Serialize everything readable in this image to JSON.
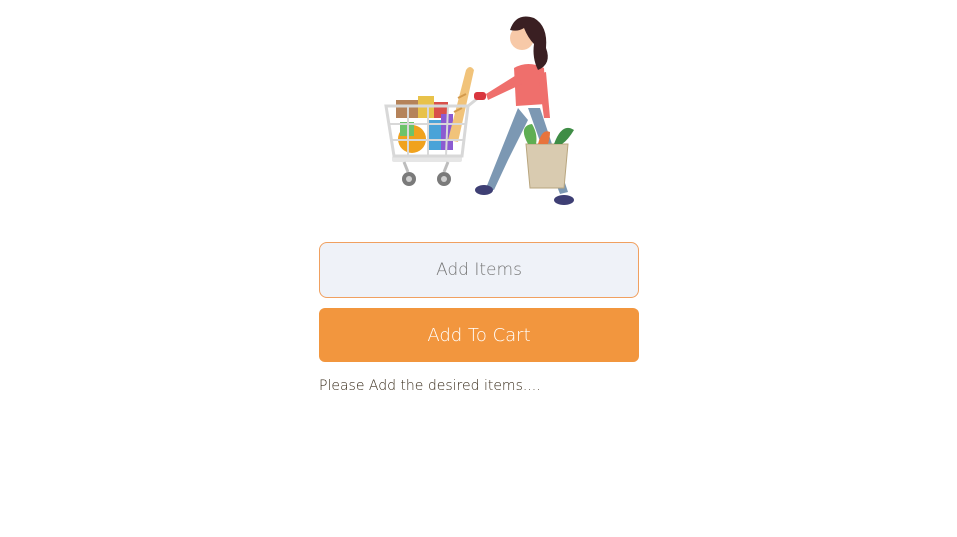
{
  "illustration": {
    "description_icon": "woman-pushing-shopping-cart-icon"
  },
  "form": {
    "input_value": "",
    "input_placeholder": "Add Items",
    "button_label": "Add To Cart",
    "status_message": "Please Add the desired items...."
  },
  "colors": {
    "button_background": "#f2963e",
    "button_text": "#ffffff",
    "input_background": "#eff2f8",
    "input_border": "#f0a060",
    "status_text": "#3a2d1c"
  }
}
